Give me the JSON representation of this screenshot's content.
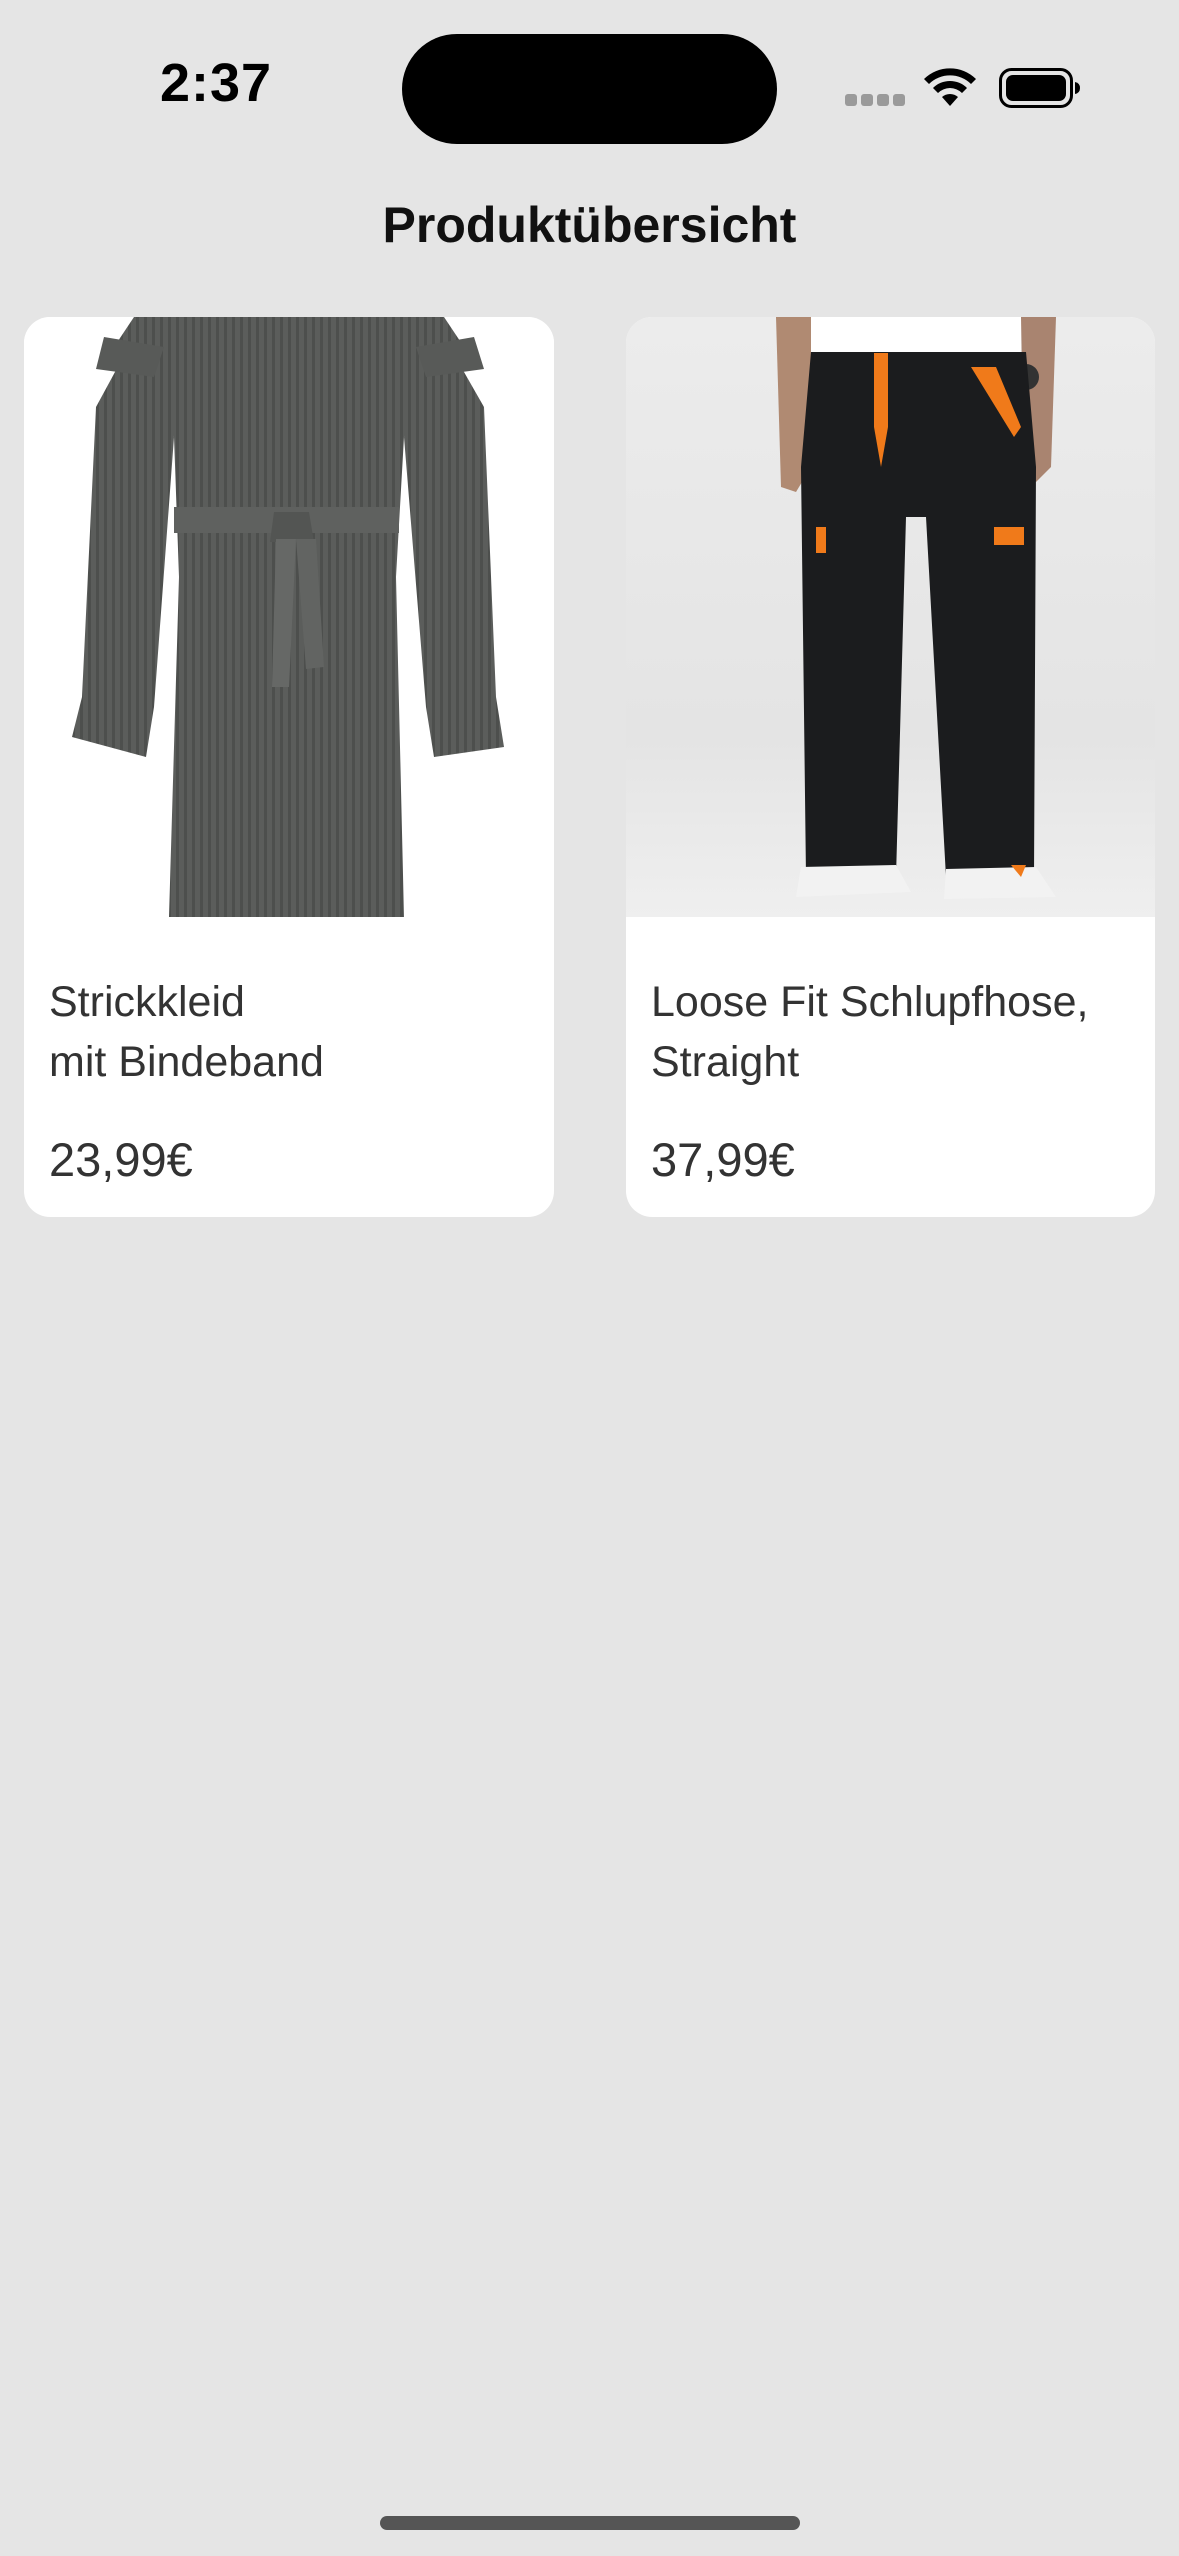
{
  "status_bar": {
    "time": "2:37"
  },
  "header": {
    "title": "Produktübersicht"
  },
  "products": [
    {
      "name": "Strickkleid\nmit Bindeband",
      "price": "23,99€",
      "image_icon": "dress-image"
    },
    {
      "name": "Loose Fit Schlupfhose,\nStraight",
      "price": "37,99€",
      "image_icon": "pants-image"
    }
  ],
  "colors": {
    "background": "#e5e5e5",
    "card": "#ffffff",
    "accent_orange": "#f07a1a"
  }
}
